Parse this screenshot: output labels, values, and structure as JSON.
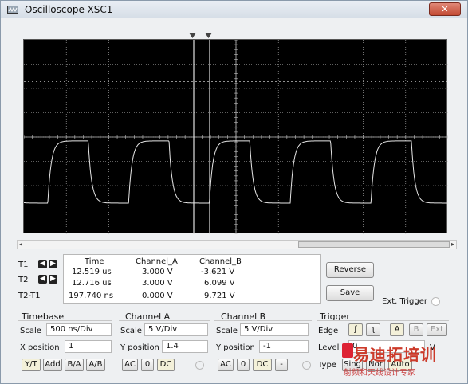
{
  "window": {
    "title": "Oscilloscope-XSC1",
    "close_label": "✕"
  },
  "readout": {
    "rows": [
      {
        "label": "T1",
        "time": "12.519 us",
        "channel_a": "3.000 V",
        "channel_b": "-3.621 V"
      },
      {
        "label": "T2",
        "time": "12.716 us",
        "channel_a": "3.000 V",
        "channel_b": "6.099 V"
      },
      {
        "label": "T2-T1",
        "time": "197.740 ns",
        "channel_a": "0.000 V",
        "channel_b": "9.721 V"
      }
    ],
    "headers": {
      "time": "Time",
      "channel_a": "Channel_A",
      "channel_b": "Channel_B"
    }
  },
  "buttons": {
    "reverse": "Reverse",
    "save": "Save"
  },
  "ext_trigger": "Ext. Trigger",
  "timebase": {
    "title": "Timebase",
    "scale_label": "Scale",
    "scale_value": "500 ns/Div",
    "xpos_label": "X position",
    "xpos_value": "1",
    "modes": [
      "Y/T",
      "Add",
      "B/A",
      "A/B"
    ]
  },
  "channel_a": {
    "title": "Channel A",
    "scale_label": "Scale",
    "scale_value": "5 V/Div",
    "ypos_label": "Y position",
    "ypos_value": "1.4",
    "coupling": [
      "AC",
      "0",
      "DC"
    ]
  },
  "channel_b": {
    "title": "Channel B",
    "scale_label": "Scale",
    "scale_value": "5 V/Div",
    "ypos_label": "Y position",
    "ypos_value": "-1",
    "coupling": [
      "AC",
      "0",
      "DC",
      "-"
    ]
  },
  "trigger": {
    "title": "Trigger",
    "edge_label": "Edge",
    "level_label": "Level",
    "level_value": "0",
    "level_unit": "V",
    "type_label": "Type",
    "edge_buttons": [
      "ʃ",
      "ʅ",
      "A",
      "B",
      "Ext"
    ],
    "type_buttons": [
      "Sing",
      "Nor",
      "Auto"
    ]
  },
  "watermark": {
    "line1": "易迪拓培训",
    "line2": "射频和天线设计专家"
  },
  "colors": {
    "screen": "#000000",
    "grid": "#bfbfbf",
    "trace": "#e6e6e6",
    "cursor": "#e0e0e0"
  }
}
